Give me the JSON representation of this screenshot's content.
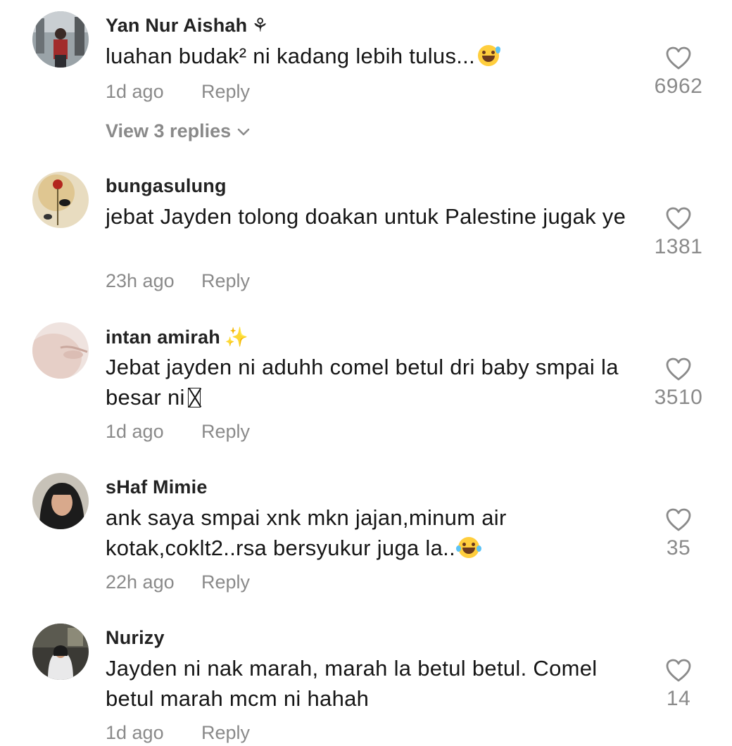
{
  "comments": [
    {
      "username": "Yan Nur Aishah",
      "username_deco": "⚘",
      "text": "luahan budak² ni kadang lebih tulus...",
      "text_emoji": "sweat-smile",
      "time": "1d ago",
      "reply_label": "Reply",
      "likes": "6962",
      "view_replies": "View 3 replies"
    },
    {
      "username": "bungasulung",
      "text": "jebat Jayden tolong doakan untuk Palestine jugak ye",
      "time": "23h ago",
      "reply_label": "Reply",
      "likes": "1381"
    },
    {
      "username": "intan amirah",
      "username_deco": "✨",
      "text": "Jebat jayden ni aduhh comel betul dri baby smpai la besar ni",
      "time": "1d ago",
      "reply_label": "Reply",
      "likes": "3510"
    },
    {
      "username": "sHaf Mimie",
      "text": "ank saya smpai xnk mkn jajan,minum air kotak,coklt2..rsa bersyukur juga la..",
      "text_emoji": "tears-of-joy",
      "time": "22h ago",
      "reply_label": "Reply",
      "likes": "35"
    },
    {
      "username": "Nurizy",
      "text": "Jayden ni nak marah, marah la betul betul. Comel betul marah mcm ni hahah",
      "time": "1d ago",
      "reply_label": "Reply",
      "likes": "14"
    }
  ],
  "icons": {
    "like": "heart-outline-icon",
    "expand": "chevron-down-icon"
  },
  "colors": {
    "text": "#161616",
    "secondary": "#8a8a8a",
    "background": "#ffffff"
  }
}
